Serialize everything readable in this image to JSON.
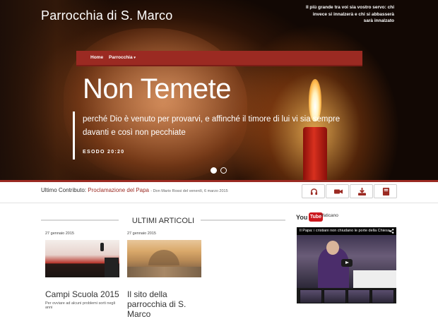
{
  "header": {
    "site_title": "Parrocchia di S. Marco",
    "motto": "Il più grande tra voi sia vostro servo: chi invece si innalzerà e chi si abbasserà sarà innalzato"
  },
  "nav": {
    "home": "Home",
    "parrocchia": "Parrocchia"
  },
  "slider": {
    "headline": "Non Temete",
    "quote": "perché Dio è venuto per provarvi, e affinché il timore di lui vi sia sempre davanti e così non pecchiate",
    "reference": "ESODO 20:20",
    "slide_count": 2,
    "active_slide": 1
  },
  "latest_contribution": {
    "label": "Ultimo Contributo:",
    "link": "Proclamazione del Papa",
    "meta": "- Don Mario Rossi del venerdì, 6 marzo 2015"
  },
  "media_buttons": [
    {
      "icon": "headphones-icon"
    },
    {
      "icon": "video-camera-icon"
    },
    {
      "icon": "download-icon"
    },
    {
      "icon": "book-icon"
    }
  ],
  "articles_section": {
    "title": "ULTIMI ARTICOLI",
    "items": [
      {
        "date": "27 gennaio 2015",
        "title": "Campi Scuola 2015",
        "excerpt": "Per ovviare ad alcuni problemi sorti negli anni"
      },
      {
        "date": "27 gennaio 2015",
        "title": "Il sito della parrocchia di S. Marco",
        "excerpt": ""
      }
    ]
  },
  "youtube": {
    "you": "You",
    "tube": "Tube",
    "channel": "Vaticano",
    "video_title": "Il Papa: i cristiani non chiudano le porte della Chiesa"
  },
  "colors": {
    "accent": "#9b2a22",
    "youtube_red": "#cc181e"
  }
}
